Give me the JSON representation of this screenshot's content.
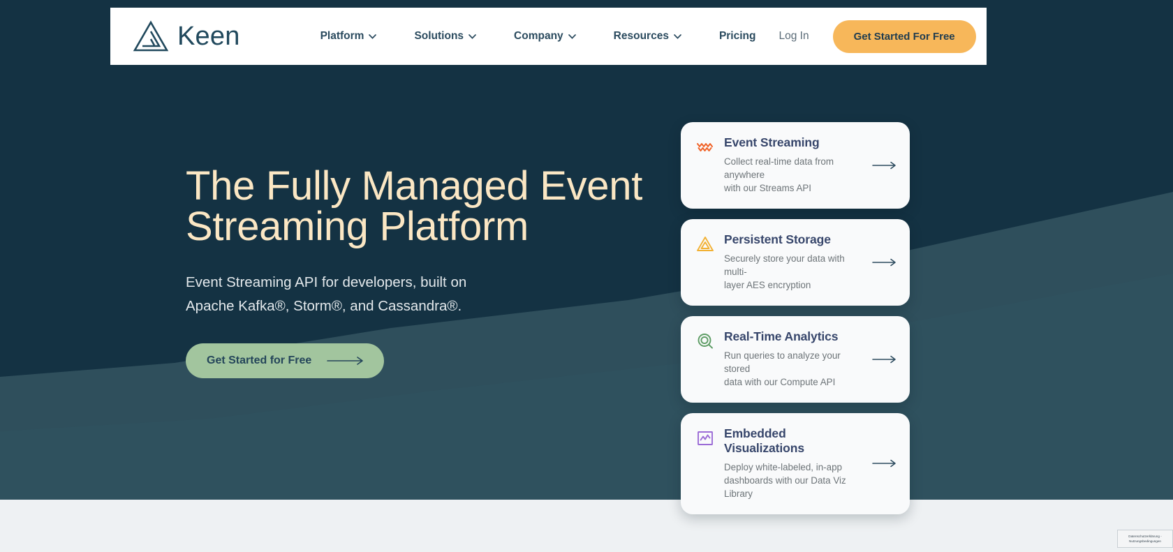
{
  "brand": {
    "name": "Keen",
    "logo_icon": "keen-triangle-logo",
    "color": "#20485C"
  },
  "header": {
    "nav_items": [
      {
        "label": "Platform",
        "has_dropdown": true,
        "icon": "chevron-down-icon"
      },
      {
        "label": "Solutions",
        "has_dropdown": true,
        "icon": "chevron-down-icon"
      },
      {
        "label": "Company",
        "has_dropdown": true,
        "icon": "chevron-down-icon"
      },
      {
        "label": "Resources",
        "has_dropdown": true,
        "icon": "chevron-down-icon"
      },
      {
        "label": "Pricing",
        "has_dropdown": false,
        "icon": ""
      }
    ],
    "login_label": "Log In",
    "cta_label": "Get Started For Free",
    "cta_color": "#F7B75A",
    "cta_text_color": "#203D50"
  },
  "hero": {
    "heading_line1": "The Fully Managed Event",
    "heading_line2": "Streaming Platform",
    "heading_color": "#FBE7C4",
    "sub_line1": "Event Streaming API for developers, built on",
    "sub_line2": "Apache Kafka®, Storm®, and Cassandra®.",
    "cta_label": "Get Started for Free",
    "cta_color": "#A2C59E",
    "cta_arrow_icon": "arrow-right-icon"
  },
  "cards": [
    {
      "title": "Event Streaming",
      "desc_line1": "Collect real-time data from anywhere",
      "desc_line2": "with our Streams API",
      "icon": "wave-lines-icon",
      "icon_color": "#F0642A",
      "arrow_icon": "arrow-right-icon"
    },
    {
      "title": "Persistent Storage",
      "desc_line1": "Securely store your data with multi-",
      "desc_line2": "layer AES encryption",
      "icon": "nested-triangle-icon",
      "icon_color": "#F2B134",
      "arrow_icon": "arrow-right-icon"
    },
    {
      "title": "Real-Time Analytics",
      "desc_line1": "Run queries to analyze your stored",
      "desc_line2": "data with our Compute API",
      "icon": "magnifier-icon",
      "icon_color": "#5B9B62",
      "arrow_icon": "arrow-right-icon"
    },
    {
      "title": "Embedded Visualizations",
      "desc_line1": "Deploy white-labeled, in-app",
      "desc_line2": "dashboards with our Data Viz Library",
      "icon": "line-chart-square-icon",
      "icon_color": "#9B6BD6",
      "arrow_icon": "arrow-right-icon"
    }
  ],
  "privacy_widget": {
    "line1": "Datenschutzerklärung -",
    "line2": "Nutzungsbedingungen"
  },
  "theme": {
    "background": "#143243",
    "wave": "#2F4F5C"
  }
}
